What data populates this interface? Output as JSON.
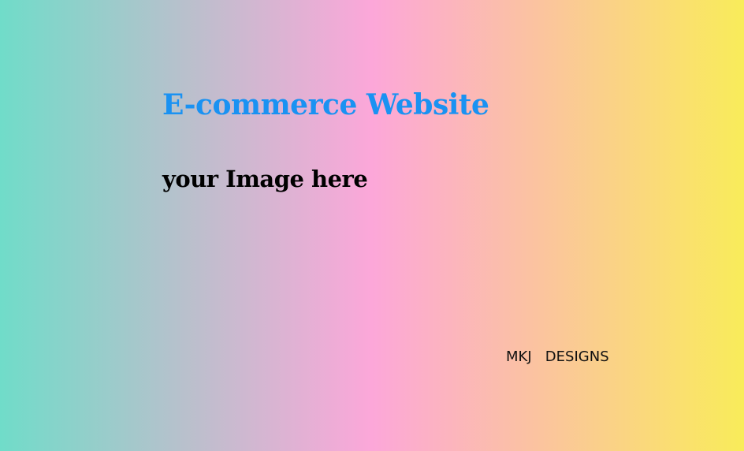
{
  "title": "E-commerce Website",
  "subtitle": "your Image here",
  "brand": "MKJ   DESIGNS",
  "colors": {
    "title": "#1a92f2",
    "gradient": [
      "#70dcc9",
      "#fca7d9",
      "#f9ec5a"
    ]
  }
}
